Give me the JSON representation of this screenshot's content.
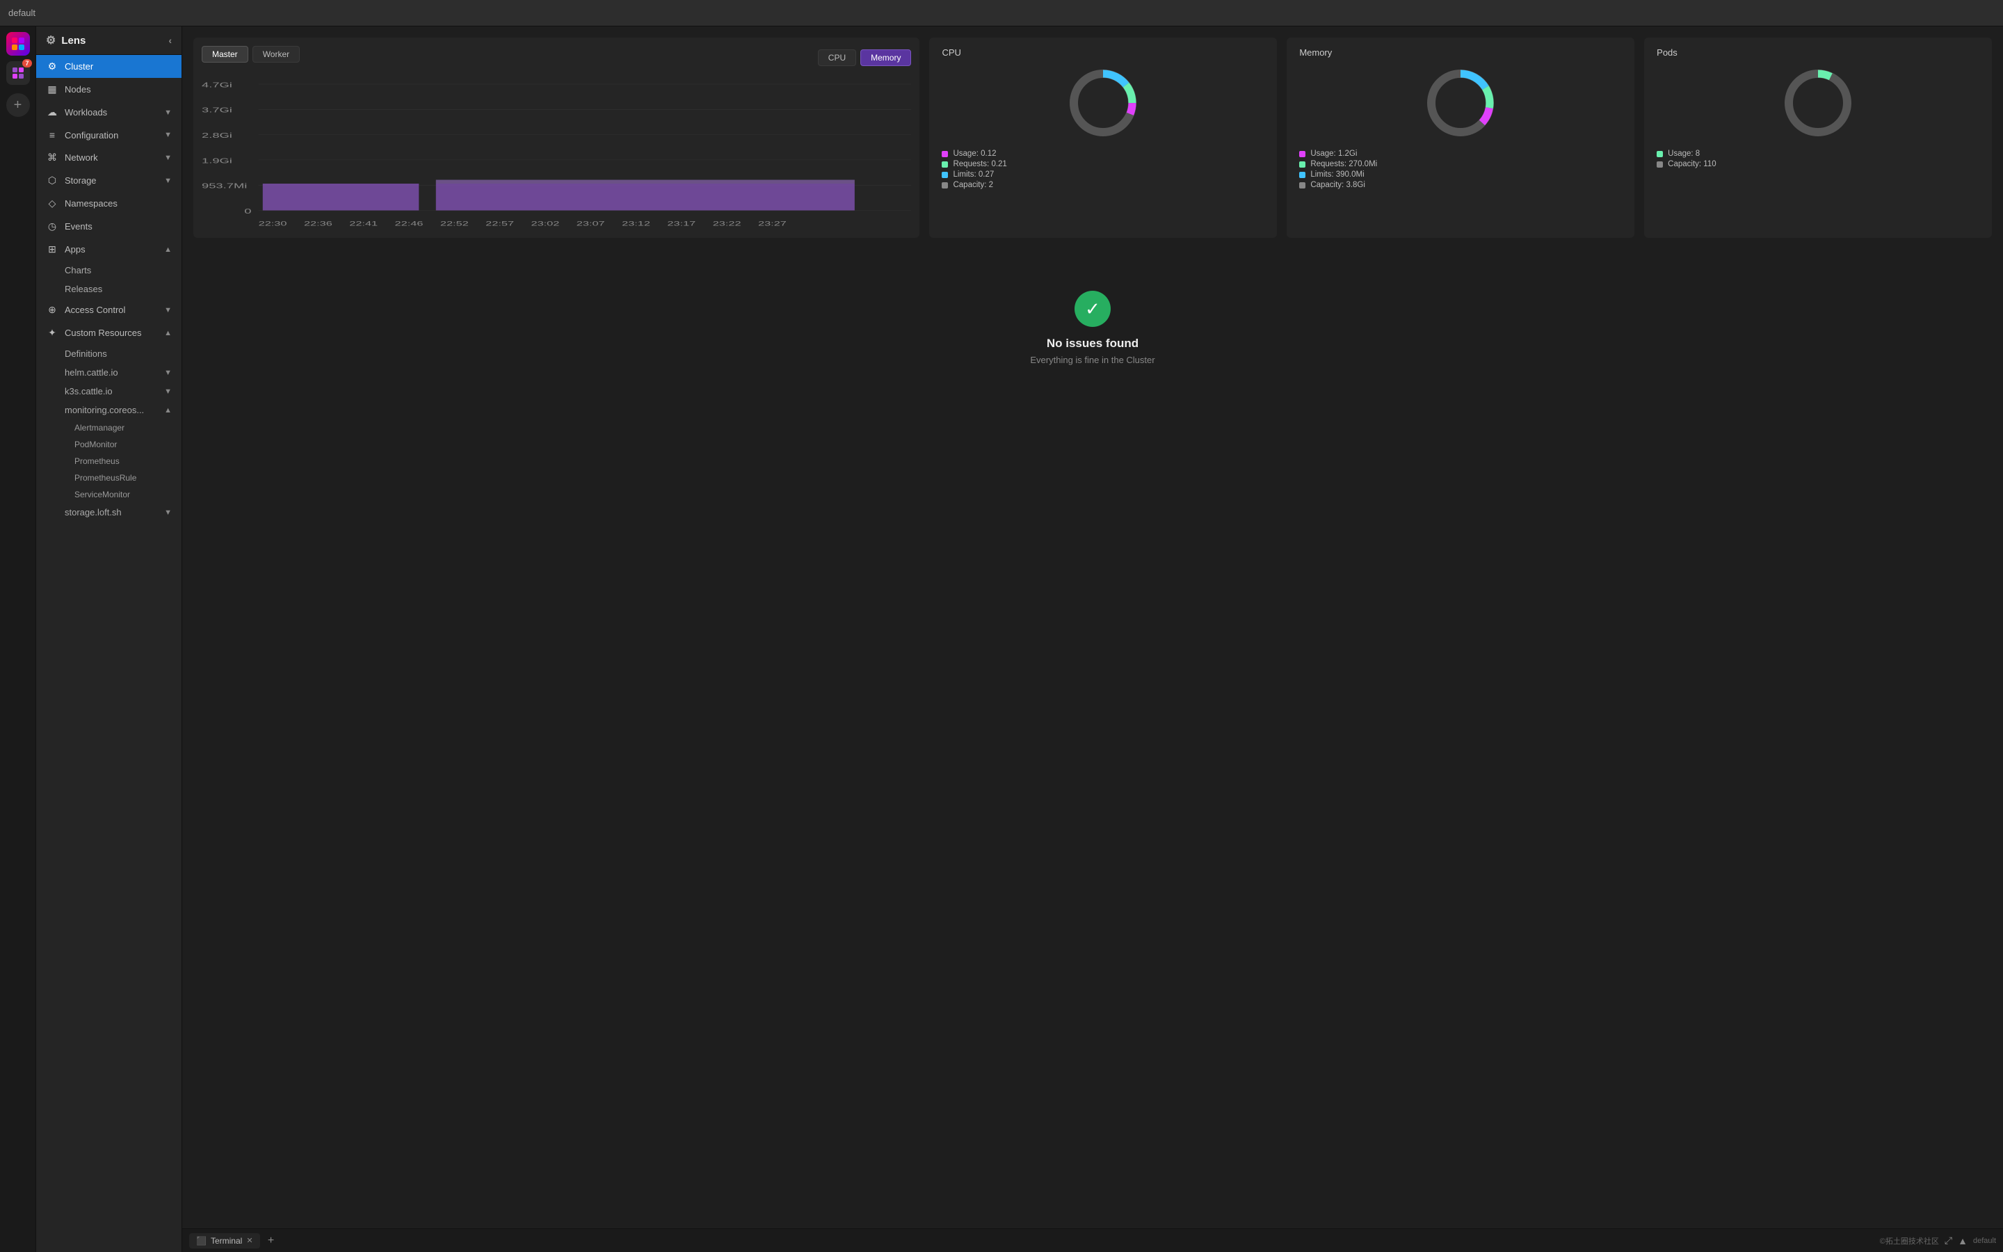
{
  "app": {
    "title": "Lens",
    "breadcrumb": "default"
  },
  "icon_sidebar": {
    "lens_badge": "7",
    "add_label": "+"
  },
  "nav": {
    "header_title": "Lens",
    "collapse_icon": "‹",
    "items": [
      {
        "id": "cluster",
        "label": "Cluster",
        "icon": "⚙",
        "active": true,
        "expandable": false
      },
      {
        "id": "nodes",
        "label": "Nodes",
        "icon": "▦",
        "active": false,
        "expandable": false
      },
      {
        "id": "workloads",
        "label": "Workloads",
        "icon": "☁",
        "active": false,
        "expandable": true
      },
      {
        "id": "configuration",
        "label": "Configuration",
        "icon": "≡",
        "active": false,
        "expandable": true
      },
      {
        "id": "network",
        "label": "Network",
        "icon": "⌘",
        "active": false,
        "expandable": true
      },
      {
        "id": "storage",
        "label": "Storage",
        "icon": "⬡",
        "active": false,
        "expandable": true
      },
      {
        "id": "namespaces",
        "label": "Namespaces",
        "icon": "◇",
        "active": false,
        "expandable": false
      },
      {
        "id": "events",
        "label": "Events",
        "icon": "◷",
        "active": false,
        "expandable": false
      }
    ],
    "apps": {
      "label": "Apps",
      "icon": "⊞",
      "sub_items": [
        "Charts",
        "Releases"
      ]
    },
    "access_control": {
      "label": "Access Control",
      "icon": "⊕",
      "expandable": true
    },
    "custom_resources": {
      "label": "Custom Resources",
      "icon": "✦",
      "expandable": true,
      "sub_items": [
        {
          "label": "Definitions"
        },
        {
          "label": "helm.cattle.io",
          "expandable": true
        },
        {
          "label": "k3s.cattle.io",
          "expandable": true
        },
        {
          "label": "monitoring.coreos...",
          "expandable": true,
          "deep_items": [
            "Alertmanager",
            "PodMonitor",
            "Prometheus",
            "PrometheusRule",
            "ServiceMonitor"
          ]
        },
        {
          "label": "storage.loft.sh",
          "expandable": true
        }
      ]
    }
  },
  "chart": {
    "node_tabs": [
      "Master",
      "Worker"
    ],
    "active_node_tab": "Memory",
    "type_tabs": [
      "CPU",
      "Memory"
    ],
    "active_type_tab": "Memory",
    "y_labels": [
      "4.7Gi",
      "3.7Gi",
      "2.8Gi",
      "1.9Gi",
      "953.7Mi",
      "0"
    ],
    "x_labels": [
      "22:30",
      "22:36",
      "22:41",
      "22:46",
      "22:52",
      "22:57",
      "23:02",
      "23:07",
      "23:12",
      "23:17",
      "23:22",
      "23:27"
    ]
  },
  "donut_cpu": {
    "title": "CPU",
    "usage_label": "Usage: 0.12",
    "requests_label": "Requests: 0.21",
    "limits_label": "Limits: 0.27",
    "capacity_label": "Capacity: 2",
    "usage_color": "#e040fb",
    "requests_color": "#69f0ae",
    "limits_color": "#40c4ff",
    "capacity_color": "#555"
  },
  "donut_memory": {
    "title": "Memory",
    "usage_label": "Usage: 1.2Gi",
    "requests_label": "Requests: 270.0Mi",
    "limits_label": "Limits: 390.0Mi",
    "capacity_label": "Capacity: 3.8Gi",
    "usage_color": "#e040fb",
    "requests_color": "#69f0ae",
    "limits_color": "#40c4ff",
    "capacity_color": "#555"
  },
  "donut_pods": {
    "title": "Pods",
    "usage_label": "Usage: 8",
    "capacity_label": "Capacity: 110",
    "usage_color": "#69f0ae",
    "capacity_color": "#555"
  },
  "no_issues": {
    "title": "No issues found",
    "subtitle": "Everything is fine in the Cluster"
  },
  "terminal": {
    "tab_label": "Terminal",
    "add_label": "+",
    "right_text": "©拓土圈技术社区",
    "namespace": "default"
  }
}
